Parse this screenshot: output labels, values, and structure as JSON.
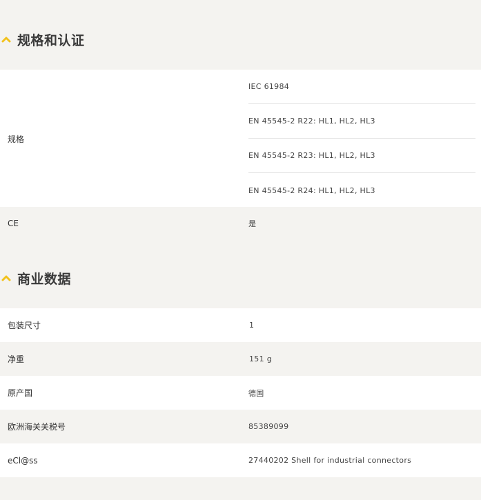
{
  "sections": [
    {
      "title": "规格和认证",
      "icon": "chevron-up-icon",
      "rows": [
        {
          "label": "规格",
          "values": [
            "IEC 61984",
            "EN 45545-2 R22: HL1, HL2, HL3",
            "EN 45545-2 R23: HL1, HL2, HL3",
            "EN 45545-2 R24: HL1, HL2, HL3"
          ]
        },
        {
          "label": "CE",
          "value": "是"
        }
      ]
    },
    {
      "title": "商业数据",
      "icon": "chevron-up-icon",
      "rows": [
        {
          "label": "包装尺寸",
          "value": "1"
        },
        {
          "label": "净重",
          "value": "151 g"
        },
        {
          "label": "原产国",
          "value": "德国"
        },
        {
          "label": "欧洲海关关税号",
          "value": "85389099"
        },
        {
          "label": "eCl@ss",
          "value": "27440202 Shell for industrial connectors"
        }
      ]
    }
  ],
  "colors": {
    "accent": "#f2c21b",
    "page_background": "#f4f3f0",
    "row_white": "#ffffff",
    "row_grey": "#f4f3f0",
    "divider": "#e2e2e2"
  }
}
